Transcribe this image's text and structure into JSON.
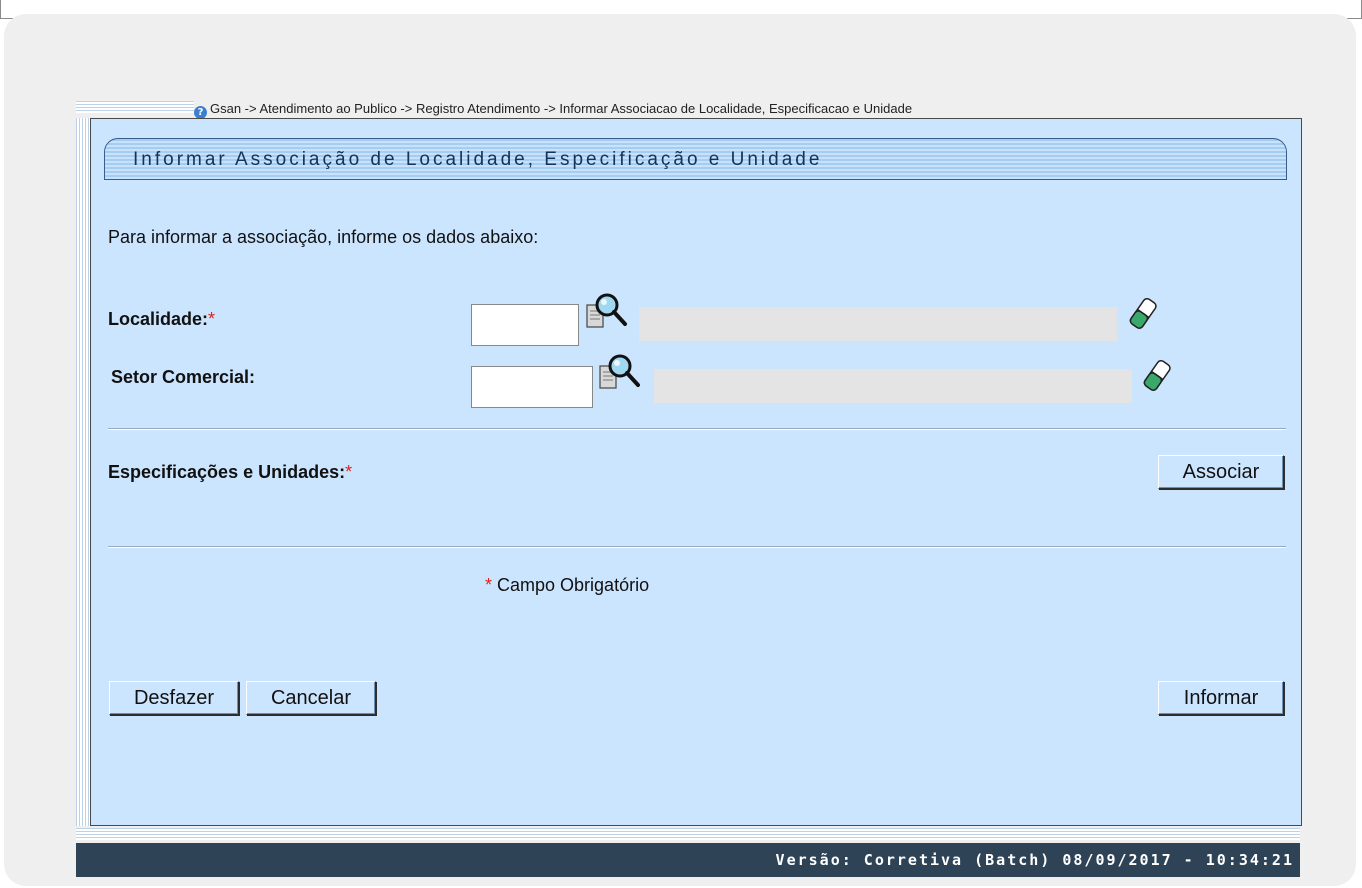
{
  "breadcrumb": {
    "icon": "help-icon",
    "text": "Gsan -> Atendimento ao Publico -> Registro Atendimento -> Informar Associacao de Localidade, Especificacao e Unidade"
  },
  "page_title": "Informar Associação de Localidade, Especificação e Unidade",
  "intro_text": "Para informar a associação, informe os dados abaixo:",
  "form": {
    "localidade": {
      "label": "Localidade:",
      "required_mark": "*",
      "value": "",
      "description": "",
      "search_icon": "magnifier-search-icon",
      "clear_icon": "eraser-icon"
    },
    "setor_comercial": {
      "label": "Setor Comercial:",
      "value": "",
      "description": "",
      "search_icon": "magnifier-search-icon",
      "clear_icon": "eraser-icon"
    },
    "especificacoes": {
      "label": "Especificações e Unidades:",
      "required_mark": "*",
      "button": "Associar"
    }
  },
  "required_note": {
    "mark": "*",
    "text": " Campo Obrigatório"
  },
  "buttons": {
    "desfazer": "Desfazer",
    "cancelar": "Cancelar",
    "informar": "Informar"
  },
  "footer": {
    "version": "Versão: Corretiva (Batch) 08/09/2017 - 10:34:21"
  },
  "colors": {
    "panel_bg": "#cce5ff",
    "title_stripe": "#a5cdf2",
    "footer_bg": "#2f4357",
    "required_red": "#e02020"
  }
}
